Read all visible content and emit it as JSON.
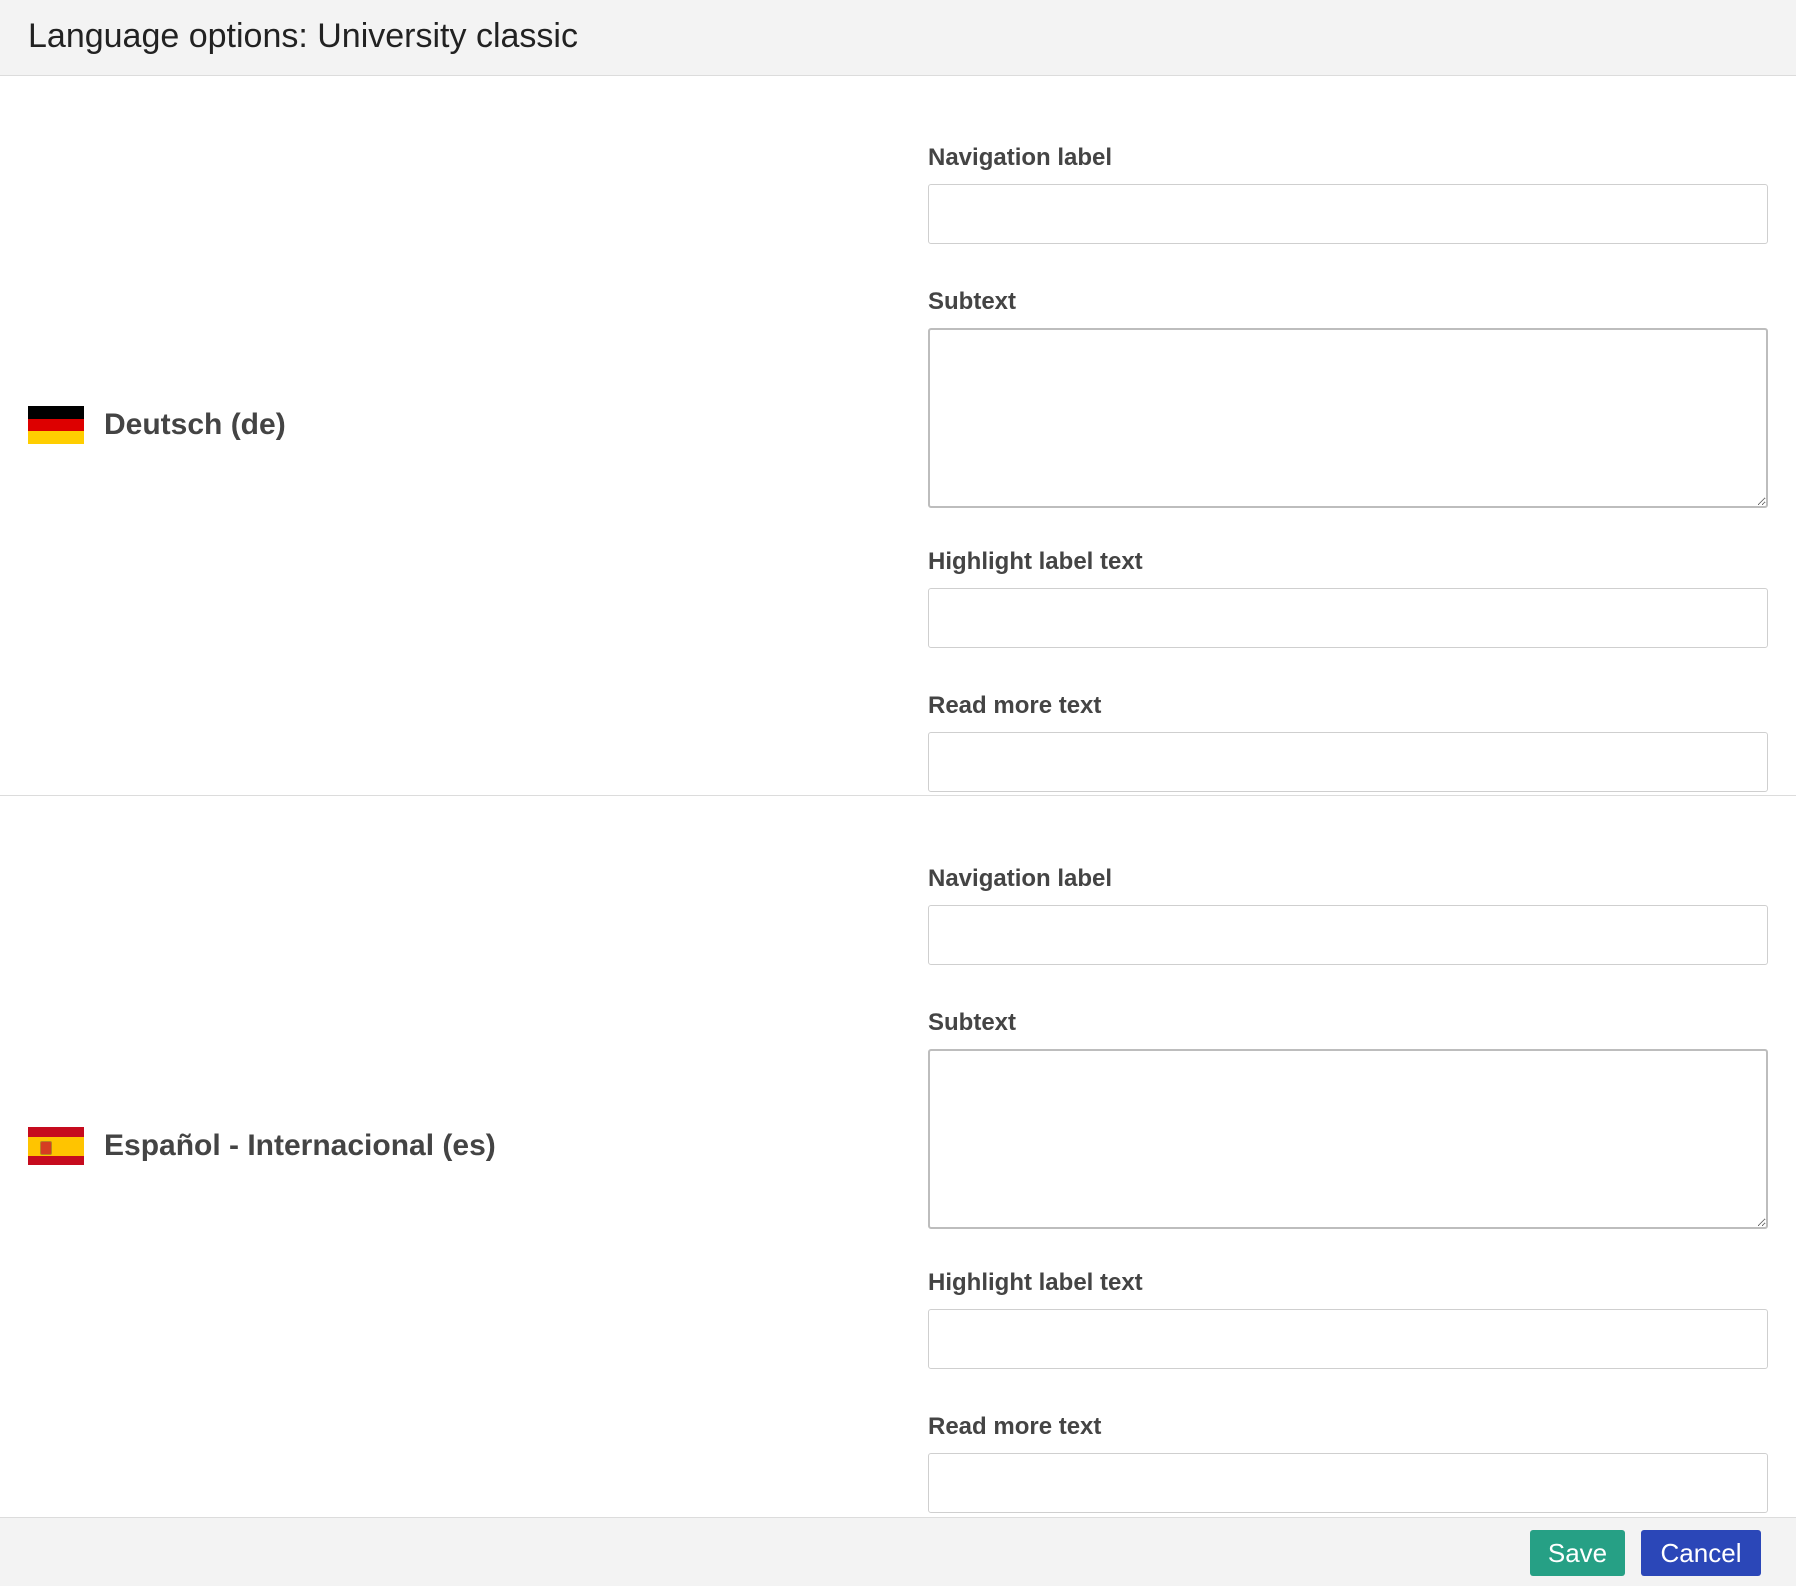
{
  "header": {
    "title": "Language options: University classic"
  },
  "languages": [
    {
      "name": "Deutsch (de)",
      "flag": "germany-flag",
      "flag_colors": [
        "#000000",
        "#dd0000",
        "#ffce00"
      ],
      "fields": {
        "navigation_label": {
          "label": "Navigation label",
          "value": ""
        },
        "subtext": {
          "label": "Subtext",
          "value": ""
        },
        "highlight_label_text": {
          "label": "Highlight label text",
          "value": ""
        },
        "read_more_text": {
          "label": "Read more text",
          "value": ""
        }
      }
    },
    {
      "name": "Español - Internacional (es)",
      "flag": "spain-flag",
      "flag_colors": [
        "#c60b1e",
        "#ffc400",
        "#c60b1e"
      ],
      "fields": {
        "navigation_label": {
          "label": "Navigation label",
          "value": ""
        },
        "subtext": {
          "label": "Subtext",
          "value": ""
        },
        "highlight_label_text": {
          "label": "Highlight label text",
          "value": ""
        },
        "read_more_text": {
          "label": "Read more text",
          "value": ""
        }
      }
    }
  ],
  "footer": {
    "save_label": "Save",
    "cancel_label": "Cancel",
    "save_color": "#26a085",
    "cancel_color": "#2b47b8"
  }
}
